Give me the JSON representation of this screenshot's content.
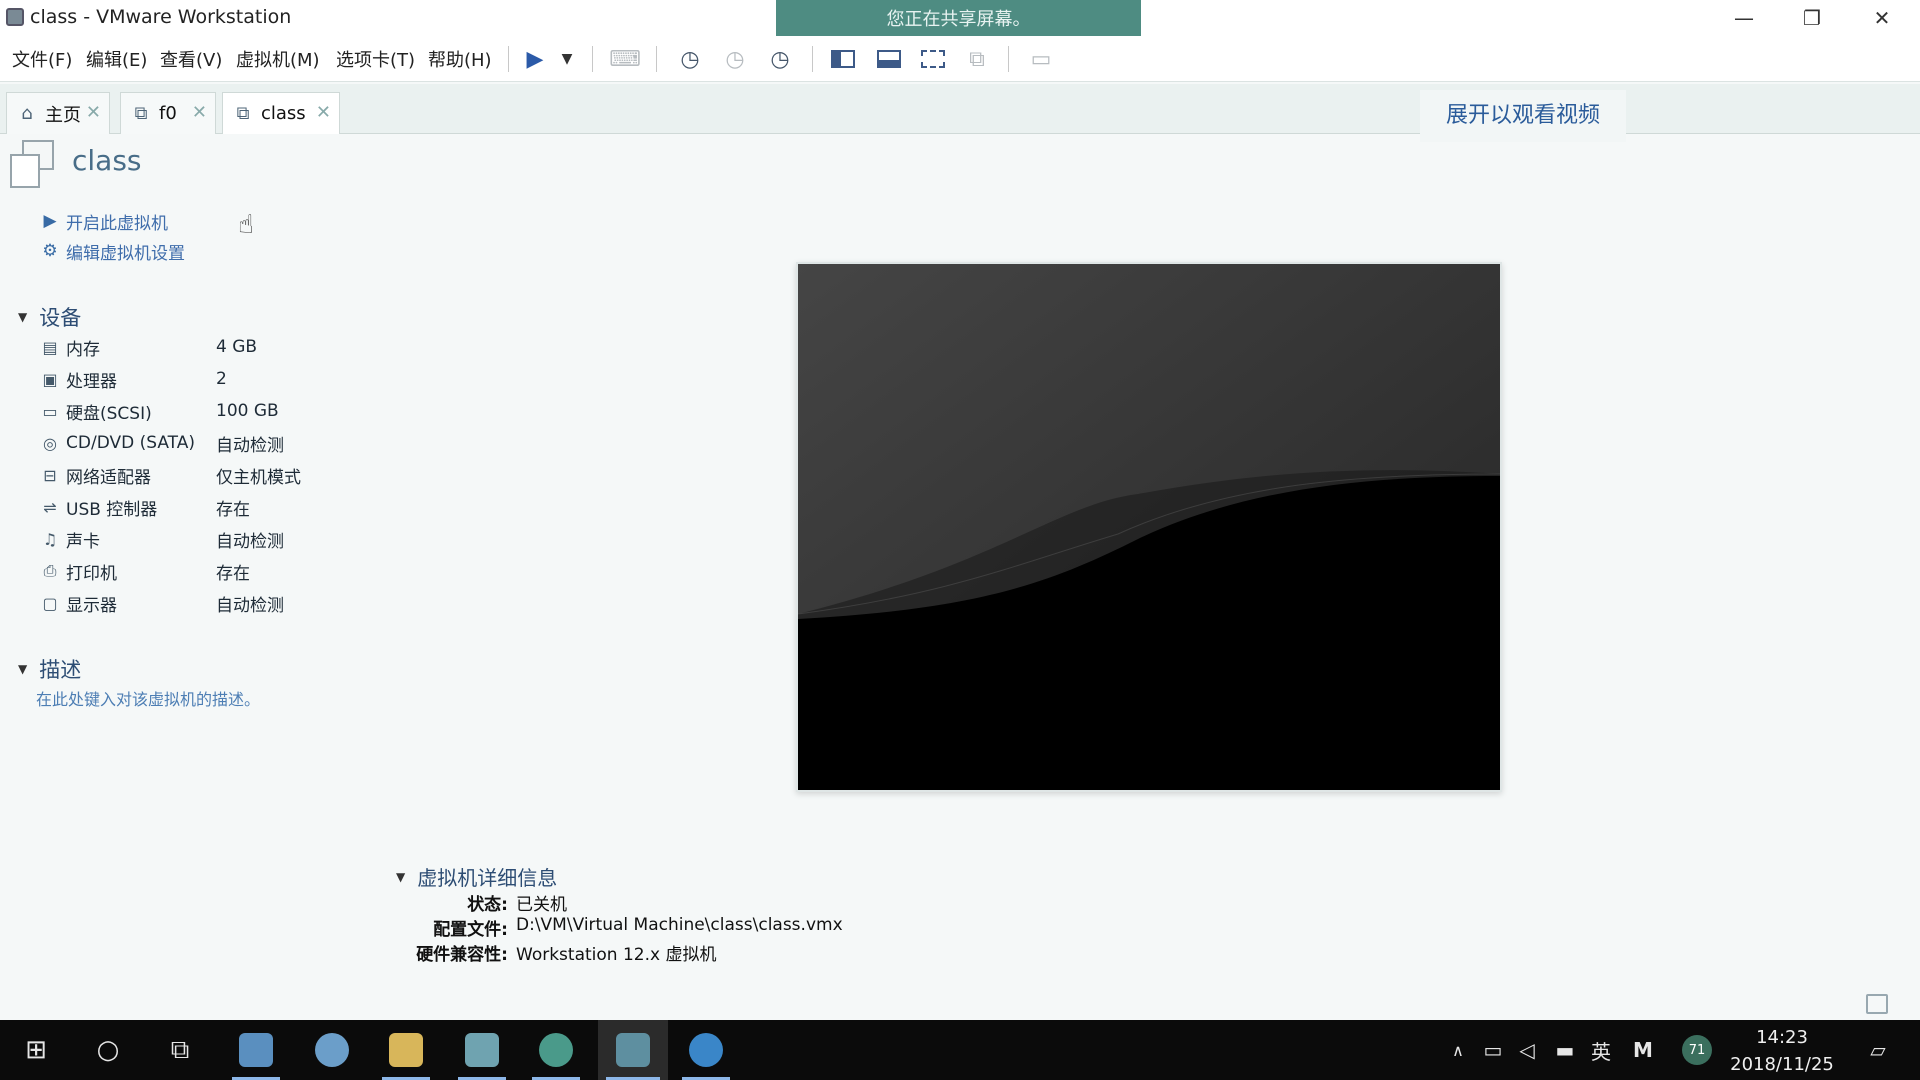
{
  "window": {
    "title": "class - VMware Workstation",
    "minimize": "—",
    "maximize": "❐",
    "close": "✕"
  },
  "share_banner": "您正在共享屏幕。",
  "menu": [
    "文件(F)",
    "编辑(E)",
    "查看(V)",
    "虚拟机(M)",
    "选项卡(T)",
    "帮助(H)"
  ],
  "tabs": [
    {
      "label": "主页",
      "icon": "home-icon"
    },
    {
      "label": "f0",
      "icon": "vm-icon"
    },
    {
      "label": "class",
      "icon": "vm-icon",
      "active": true
    }
  ],
  "expand_video": "展开以观看视频",
  "vm": {
    "name": "class",
    "actions": {
      "power_on": "开启此虚拟机",
      "edit_settings": "编辑虚拟机设置"
    }
  },
  "devices": {
    "title": "设备",
    "items": [
      {
        "name": "内存",
        "value": "4 GB",
        "icon": "memory-icon"
      },
      {
        "name": "处理器",
        "value": "2",
        "icon": "cpu-icon"
      },
      {
        "name": "硬盘(SCSI)",
        "value": "100 GB",
        "icon": "harddisk-icon"
      },
      {
        "name": "CD/DVD (SATA)",
        "value": "自动检测",
        "icon": "cd-icon"
      },
      {
        "name": "网络适配器",
        "value": "仅主机模式",
        "icon": "network-icon"
      },
      {
        "name": "USB 控制器",
        "value": "存在",
        "icon": "usb-icon"
      },
      {
        "name": "声卡",
        "value": "自动检测",
        "icon": "sound-icon"
      },
      {
        "name": "打印机",
        "value": "存在",
        "icon": "printer-icon"
      },
      {
        "name": "显示器",
        "value": "自动检测",
        "icon": "monitor-icon"
      }
    ]
  },
  "description": {
    "title": "描述",
    "placeholder": "在此处键入对该虚拟机的描述。"
  },
  "details": {
    "title": "虚拟机详细信息",
    "state_label": "状态:",
    "state_value": "已关机",
    "config_label": "配置文件:",
    "config_value": "D:\\VM\\Virtual Machine\\class\\class.vmx",
    "compat_label": "硬件兼容性:",
    "compat_value": "Workstation 12.x 虚拟机"
  },
  "taskbar": {
    "tray_lang": "英",
    "tray_m": "M",
    "tray_badge": "71",
    "time": "14:23",
    "date": "2018/11/25"
  }
}
